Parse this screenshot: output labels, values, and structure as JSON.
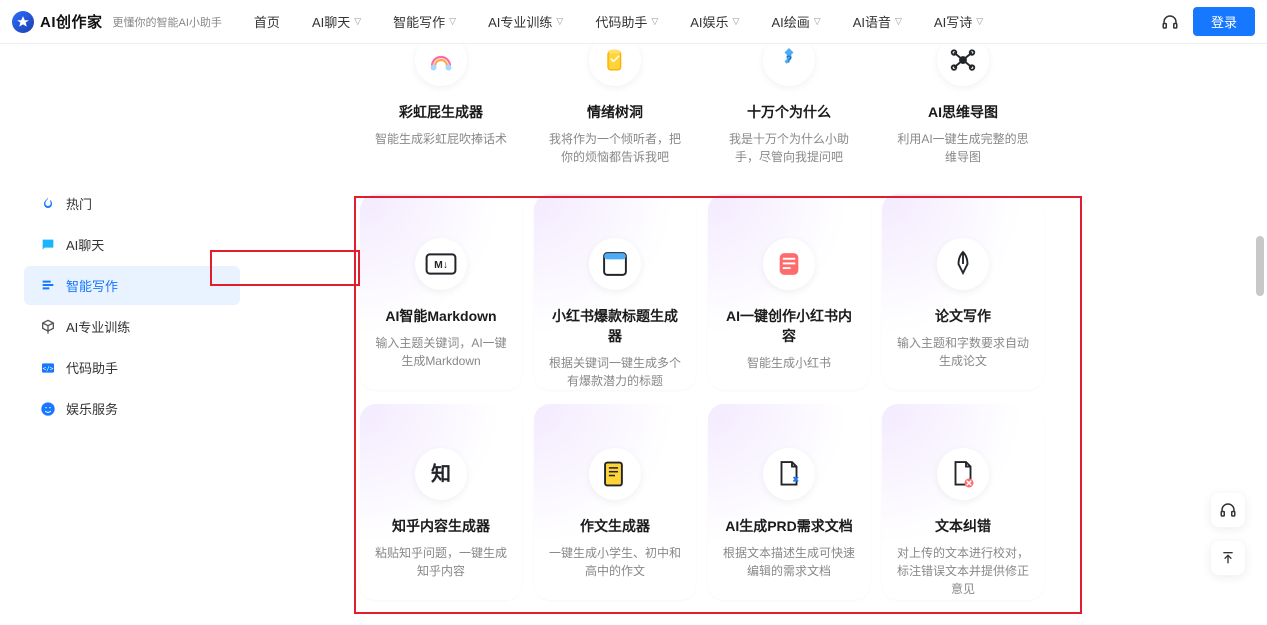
{
  "header": {
    "brand": "AI创作家",
    "tagline": "更懂你的智能AI小助手",
    "nav": [
      {
        "label": "首页",
        "has_dropdown": false
      },
      {
        "label": "AI聊天",
        "has_dropdown": true
      },
      {
        "label": "智能写作",
        "has_dropdown": true
      },
      {
        "label": "AI专业训练",
        "has_dropdown": true
      },
      {
        "label": "代码助手",
        "has_dropdown": true
      },
      {
        "label": "AI娱乐",
        "has_dropdown": true
      },
      {
        "label": "AI绘画",
        "has_dropdown": true
      },
      {
        "label": "AI语音",
        "has_dropdown": true
      },
      {
        "label": "AI写诗",
        "has_dropdown": true
      }
    ],
    "login_label": "登录"
  },
  "sidebar": {
    "items": [
      {
        "label": "热门",
        "icon": "fire-icon"
      },
      {
        "label": "AI聊天",
        "icon": "chat-icon"
      },
      {
        "label": "智能写作",
        "icon": "edit-icon",
        "active": true
      },
      {
        "label": "AI专业训练",
        "icon": "cube-icon"
      },
      {
        "label": "代码助手",
        "icon": "code-icon"
      },
      {
        "label": "娱乐服务",
        "icon": "smile-icon"
      }
    ]
  },
  "cards_row1": [
    {
      "title": "彩虹屁生成器",
      "desc": "智能生成彩虹屁吹捧话术",
      "icon": "rainbow-icon"
    },
    {
      "title": "情绪树洞",
      "desc": "我将作为一个倾听者，把你的烦恼都告诉我吧",
      "icon": "cup-icon"
    },
    {
      "title": "十万个为什么",
      "desc": "我是十万个为什么小助手，尽管向我提问吧",
      "icon": "question-icon"
    },
    {
      "title": "AI思维导图",
      "desc": "利用AI一键生成完整的思维导图",
      "icon": "mindmap-icon"
    }
  ],
  "cards_row2": [
    {
      "title": "AI智能Markdown",
      "desc": "输入主题关键词，AI一键生成Markdown",
      "icon": "markdown-icon"
    },
    {
      "title": "小红书爆款标题生成器",
      "desc": "根据关键词一键生成多个有爆款潜力的标题",
      "icon": "window-icon"
    },
    {
      "title": "AI一键创作小红书内容",
      "desc": "智能生成小红书",
      "icon": "note-icon"
    },
    {
      "title": "论文写作",
      "desc": "输入主题和字数要求自动生成论文",
      "icon": "pen-icon"
    }
  ],
  "cards_row3": [
    {
      "title": "知乎内容生成器",
      "desc": "粘贴知乎问题，一键生成知乎内容",
      "icon": "zhihu-icon"
    },
    {
      "title": "作文生成器",
      "desc": "一键生成小学生、初中和高中的作文",
      "icon": "essay-icon"
    },
    {
      "title": "AI生成PRD需求文档",
      "desc": "根据文本描述生成可快速编辑的需求文档",
      "icon": "doc-edit-icon"
    },
    {
      "title": "文本纠错",
      "desc": "对上传的文本进行校对，标注错误文本并提供修正意见",
      "icon": "doc-error-icon"
    }
  ]
}
